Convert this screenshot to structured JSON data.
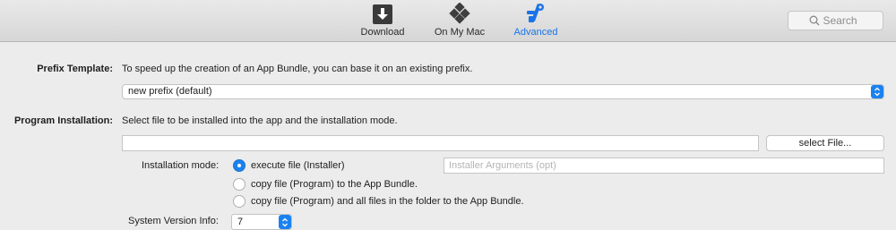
{
  "toolbar": {
    "items": [
      {
        "label": "Download",
        "icon": "download-icon"
      },
      {
        "label": "On My Mac",
        "icon": "on-my-mac-icon"
      },
      {
        "label": "Advanced",
        "icon": "advanced-tools-icon",
        "selected": true
      }
    ],
    "search": {
      "placeholder": "Search"
    }
  },
  "prefix": {
    "label": "Prefix Template:",
    "description": "To speed up the creation of an App Bundle, you can base it on an existing prefix.",
    "selected": "new prefix (default)"
  },
  "program": {
    "label": "Program Installation:",
    "description": "Select file to be installed into the app and the installation mode.",
    "file_value": "",
    "select_button": "select File...",
    "mode_label": "Installation mode:",
    "modes": [
      {
        "label": "execute file (Installer)",
        "selected": true
      },
      {
        "label": "copy file (Program)  to the App Bundle.",
        "selected": false
      },
      {
        "label": "copy file (Program)  and all files in the folder to the App Bundle.",
        "selected": false
      }
    ],
    "args_placeholder": "Installer Arguments (opt)"
  },
  "version": {
    "label": "System Version Info:",
    "value": "7"
  },
  "colors": {
    "accent": "#1a82f0",
    "selected_text": "#1a73e8",
    "background": "#ececec"
  }
}
